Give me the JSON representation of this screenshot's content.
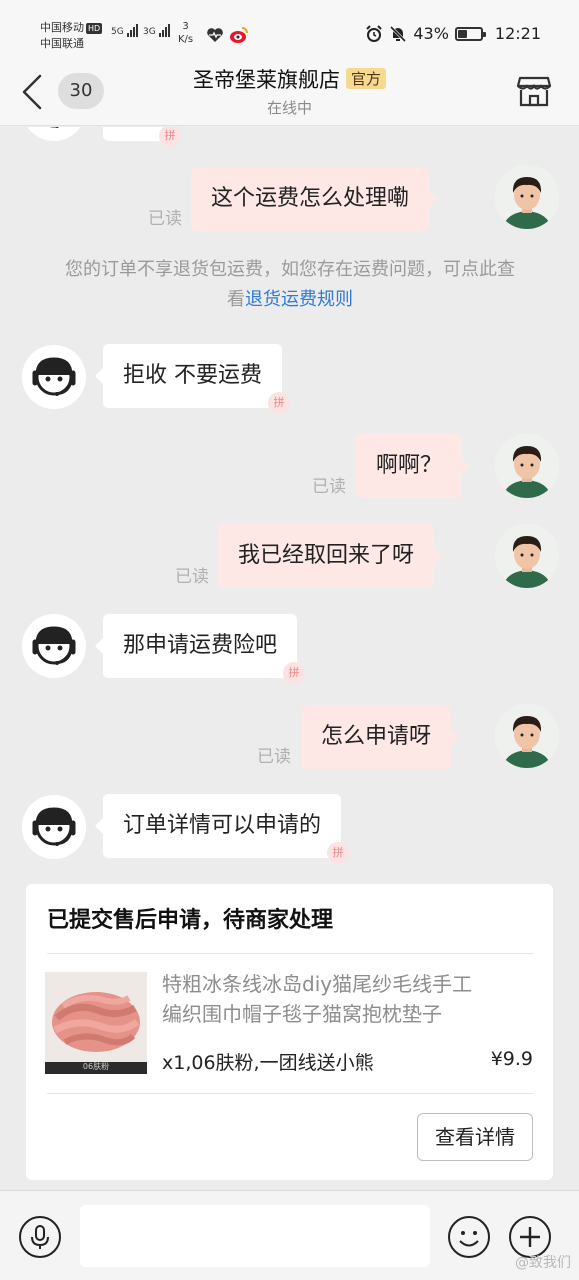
{
  "status_bar": {
    "carrier1": "中国移动",
    "hd": "HD",
    "carrier2": "中国联通",
    "net1": "5G",
    "net2": "3G",
    "speed_value": "3",
    "speed_unit": "K/s",
    "battery_percent": "43%",
    "battery_level": 0.43,
    "time": "12:21"
  },
  "header": {
    "unread_count": "30",
    "shop_name": "圣帝堡莱旗舰店",
    "official_tag": "官方",
    "status": "在线中"
  },
  "messages": [
    {
      "side": "right",
      "text": "这个运费怎么处理嘞",
      "read": "已读"
    },
    {
      "side": "left",
      "text": "拒收 不要运费"
    },
    {
      "side": "right",
      "text": "啊啊？",
      "read": "已读"
    },
    {
      "side": "right",
      "text": "我已经取回来了呀",
      "read": "已读"
    },
    {
      "side": "left",
      "text": "那申请运费险吧"
    },
    {
      "side": "right",
      "text": "怎么申请呀",
      "read": "已读"
    },
    {
      "side": "left",
      "text": "订单详情可以申请的"
    }
  ],
  "system_note": {
    "text": "您的订单不享退货包运费，如您存在运费问题，可点此查看",
    "link": "退货运费规则"
  },
  "stamp_text": "拼",
  "order_card": {
    "title": "已提交售后申请，待商家处理",
    "product_name_line1": "特粗冰条线冰岛diy猫尾纱毛线手工",
    "product_name_line2": "编织围巾帽子毯子猫窝抱枕垫子",
    "image_caption": "06肤粉",
    "sku": "x1,06肤粉,一团线送小熊",
    "price": "¥9.9",
    "detail_button": "查看详情"
  },
  "input_bar": {
    "placeholder": ""
  },
  "watermark": "@致我们",
  "icons": {
    "back": "chevron-left-icon",
    "shop": "store-icon",
    "mic": "microphone-icon",
    "emoji": "smiley-icon",
    "plus": "plus-icon"
  },
  "colors": {
    "link": "#2e7ad6",
    "user_bubble": "#fde8e5",
    "official_tag": "#f6d991"
  }
}
